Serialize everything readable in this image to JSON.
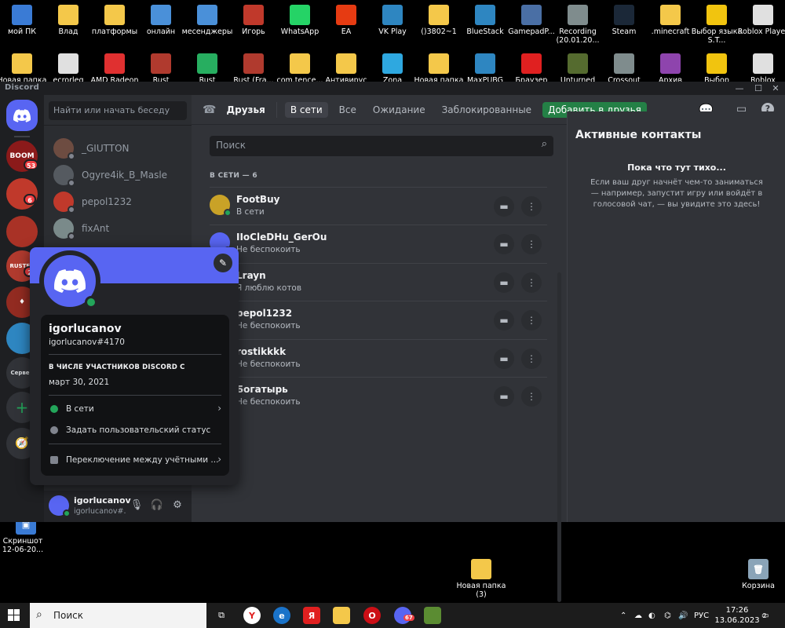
{
  "desktop": {
    "row1": [
      "мой ПК",
      "Влад",
      "платформы",
      "онлайн",
      "месенджеры",
      "Игорь",
      "WhatsApp",
      "EA",
      "VK Play",
      "()3802~1",
      "BlueStack",
      "GamepadP...",
      "Recording (20.01.20...",
      "Steam",
      ".minecraft",
      "Выбор языка S.T...",
      "Roblox Player"
    ],
    "row2": [
      "Новая папка",
      "ecrorleg",
      "AMD Radeon",
      "Rust",
      "Rust",
      "Rust (Fra...",
      "com.tence...",
      "Антивирус",
      "Zona",
      "Новая папка",
      "MaxPUBG",
      "Браузер",
      "Unturned",
      "Crossout",
      "Архив",
      "Выбор",
      "Roblox"
    ],
    "left_icon": "Скриншот 12-06-20...",
    "folder_icon": "Новая папка (3)",
    "recycle_icon": "Корзина",
    "colors": {
      "folder": "#f4c84a",
      "whatsapp": "#25d366",
      "ea": "#e63b12",
      "steam": "#1b2838"
    }
  },
  "discord": {
    "window_title": "Discord",
    "window_controls": [
      "—",
      "☐",
      "✕"
    ],
    "dm_search_placeholder": "Найти или начать беседу",
    "server_labels": {
      "s1": "BOOM",
      "s5": "RUSTER",
      "s8": "Сервер"
    },
    "server_badges": [
      "53",
      "6",
      "2"
    ],
    "dm_list": [
      {
        "name": "_GIUTTON",
        "color": "#6d4c41"
      },
      {
        "name": "Ogyre4ik_B_Masle",
        "color": "#555a60"
      },
      {
        "name": "pepol1232",
        "color": "#c0392b"
      },
      {
        "name": "fixAnt",
        "color": "#7a8a8a"
      }
    ],
    "user_panel": {
      "name": "igorlucanov",
      "tag": "igorlucanov#..."
    },
    "topbar": {
      "friends": "Друзья",
      "online": "В сети",
      "all": "Все",
      "pending": "Ожидание",
      "blocked": "Заблокированные",
      "add_friend": "Добавить в друзья"
    },
    "friends_search_placeholder": "Поиск",
    "online_count": "В СЕТИ — 6",
    "friends": [
      {
        "name": "FootBuy",
        "status": "В сети",
        "color": "#c9a227"
      },
      {
        "name": "IIoCleDHu_GerOu",
        "status": "Не беспокоить",
        "color": "#5865f2"
      },
      {
        "name": "Lrayn",
        "status": "Я люблю котов",
        "color": "#8a6d3b"
      },
      {
        "name": "pepol1232",
        "status": "Не беспокоить",
        "color": "#c0392b"
      },
      {
        "name": "rostikkkk",
        "status": "Не беспокоить",
        "color": "#4a6fa5"
      },
      {
        "name": "Богатырь",
        "status": "Не беспокоить",
        "color": "#556b2f"
      }
    ],
    "active_now": {
      "title": "Активные контакты",
      "empty_title": "Пока что тут тихо...",
      "empty_text": "Если ваш друг начнёт чем-то заниматься — например, запустит игру или войдёт в голосовой чат, — вы увидите это здесь!"
    },
    "profile": {
      "username": "igorlucanov",
      "tag": "igorlucanov#4170",
      "member_since_label": "В ЧИСЛЕ УЧАСТНИКОВ DISCORD С",
      "member_since": "март 30, 2021",
      "status_option": "В сети",
      "custom_status": "Задать пользовательский статус",
      "switch_accounts": "Переключение между учётными ..."
    },
    "colors": {
      "blurple": "#5865f2",
      "online": "#23a55a",
      "dnd": "#f23f43",
      "add_friend": "#248046"
    }
  },
  "taskbar": {
    "search": "Поиск",
    "lang": "РУС",
    "time": "17:26",
    "date": "13.06.2023",
    "notif_count": "2",
    "discord_badge": "67"
  }
}
